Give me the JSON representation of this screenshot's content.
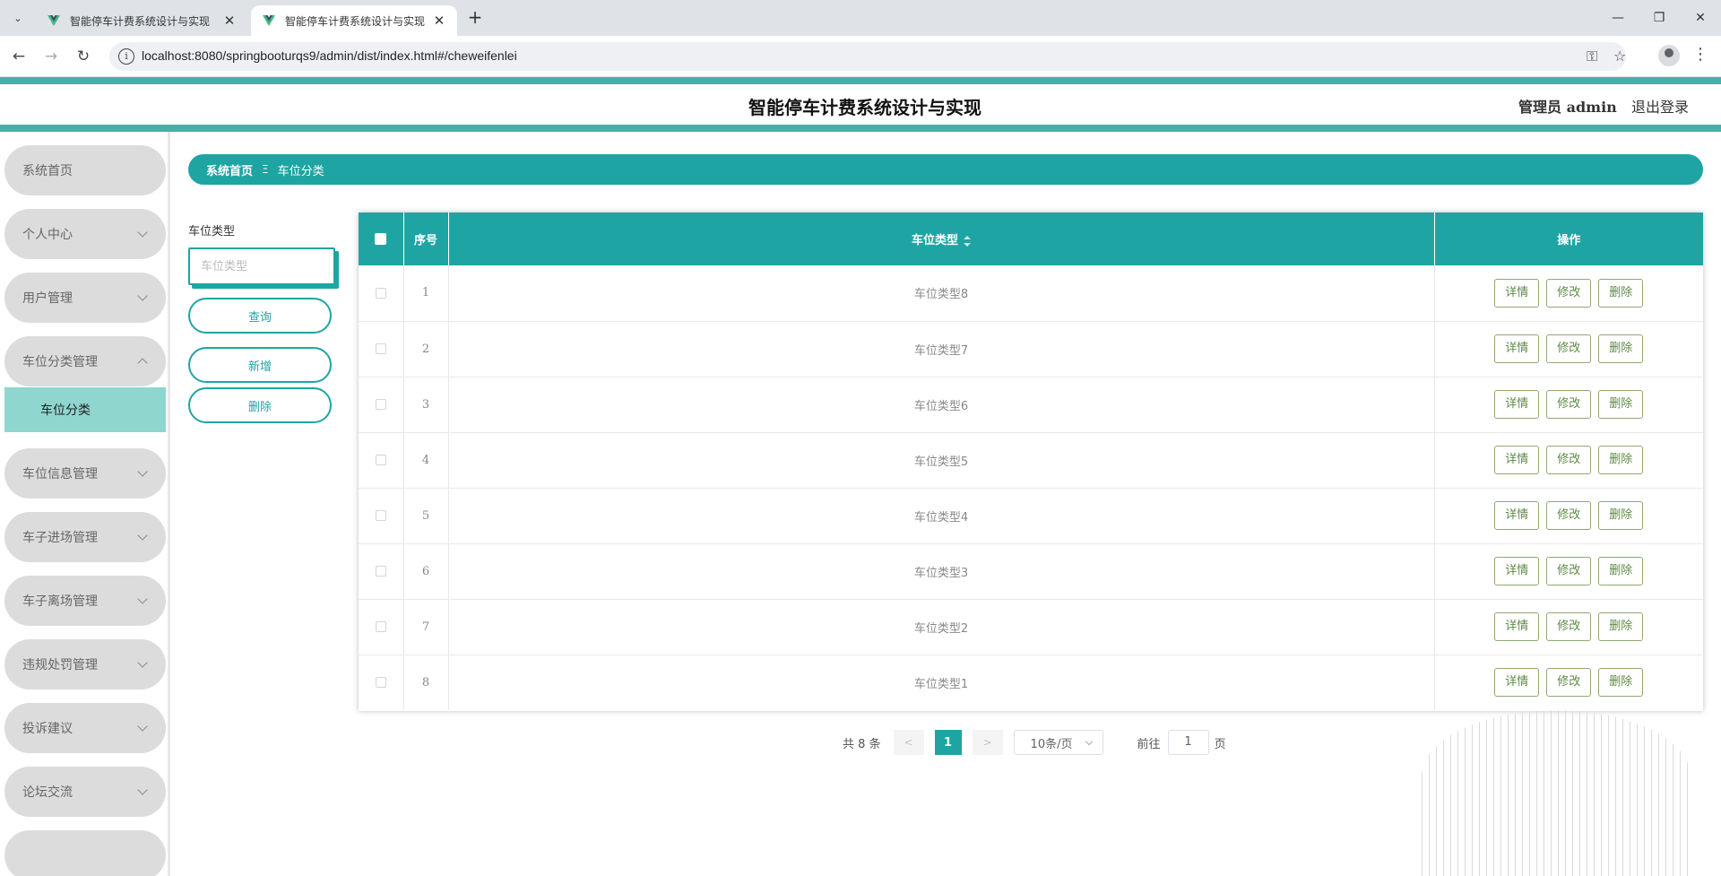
{
  "browser": {
    "tabs": [
      {
        "title": "智能停车计费系统设计与实现",
        "active": false
      },
      {
        "title": "智能停车计费系统设计与实现",
        "active": true
      }
    ],
    "url": "localhost:8080/springbooturqs9/admin/dist/index.html#/cheweifenlei"
  },
  "header": {
    "title": "智能停车计费系统设计与实现",
    "user_role": "管理员",
    "username": "admin",
    "logout": "退出登录"
  },
  "sidebar": {
    "items": [
      {
        "label": "系统首页"
      },
      {
        "label": "个人中心"
      },
      {
        "label": "用户管理"
      },
      {
        "label": "车位分类管理"
      },
      {
        "label": "车位信息管理"
      },
      {
        "label": "车子进场管理"
      },
      {
        "label": "车子离场管理"
      },
      {
        "label": "违规处罚管理"
      },
      {
        "label": "投诉建议"
      },
      {
        "label": "论坛交流"
      }
    ],
    "active_sub": "车位分类"
  },
  "breadcrumb": {
    "home": "系统首页",
    "current": "车位分类"
  },
  "search": {
    "label": "车位类型",
    "placeholder": "车位类型",
    "query_button": "查询",
    "add_button": "新增",
    "delete_button": "删除"
  },
  "table": {
    "headers": {
      "index": "序号",
      "type": "车位类型",
      "actions": "操作"
    },
    "rows": [
      {
        "index": "1",
        "type": "车位类型8"
      },
      {
        "index": "2",
        "type": "车位类型7"
      },
      {
        "index": "3",
        "type": "车位类型6"
      },
      {
        "index": "4",
        "type": "车位类型5"
      },
      {
        "index": "5",
        "type": "车位类型4"
      },
      {
        "index": "6",
        "type": "车位类型3"
      },
      {
        "index": "7",
        "type": "车位类型2"
      },
      {
        "index": "8",
        "type": "车位类型1"
      }
    ],
    "actions": {
      "detail": "详情",
      "edit": "修改",
      "delete": "删除"
    }
  },
  "pagination": {
    "total": "共 8 条",
    "prev": "<",
    "next": ">",
    "current_page": "1",
    "page_size": "10条/页",
    "goto_label": "前往",
    "goto_value": "1",
    "goto_suffix": "页"
  },
  "colors": {
    "accent": "#1ea5a3",
    "header_border": "#45b0aa",
    "active_submenu": "#8fd6cf"
  }
}
